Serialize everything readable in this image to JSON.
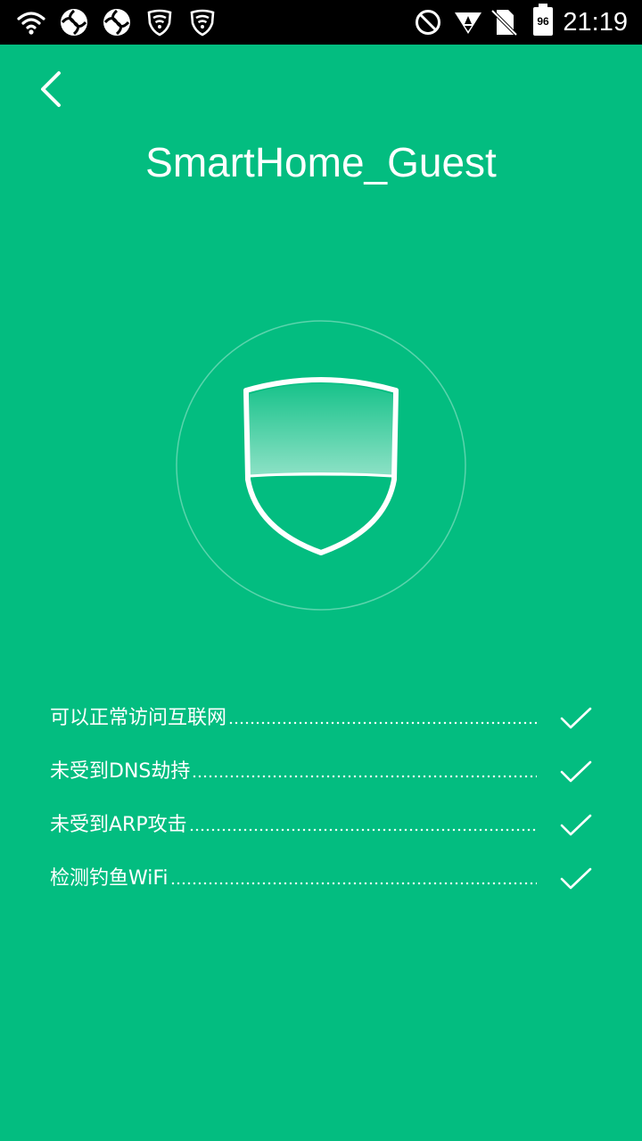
{
  "status_bar": {
    "time": "21:19",
    "battery_level": "96",
    "icons": [
      "wifi-icon",
      "vpn-icon",
      "vpn-icon",
      "shield-signal-icon",
      "shield-signal-icon",
      "do-not-disturb-icon",
      "mobile-signal-icon",
      "no-sim-icon",
      "battery-icon"
    ]
  },
  "header": {
    "back_icon": "chevron-left-icon",
    "title": "SmartHome_Guest"
  },
  "shield": {
    "icon": "shield-icon"
  },
  "checks": [
    {
      "label": "可以正常访问互联网",
      "status": "check-icon"
    },
    {
      "label": "未受到DNS劫持",
      "status": "check-icon"
    },
    {
      "label": "未受到ARP攻击",
      "status": "check-icon"
    },
    {
      "label": "检测钓鱼WiFi",
      "status": "check-icon"
    }
  ],
  "colors": {
    "background": "#03bd80",
    "status_bar": "#000000",
    "foreground": "#ffffff"
  }
}
